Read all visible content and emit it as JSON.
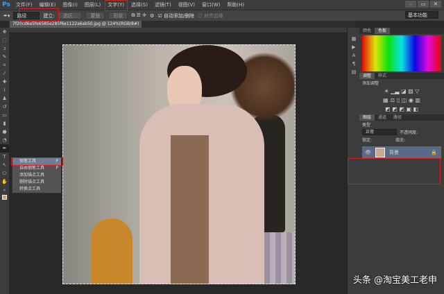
{
  "app": {
    "logo": "Ps"
  },
  "menu": [
    "文件(F)",
    "编辑(E)",
    "图像(I)",
    "图层(L)",
    "文字(Y)",
    "选择(S)",
    "滤镜(T)",
    "视图(V)",
    "窗口(W)",
    "帮助(H)"
  ],
  "window_buttons": [
    "–",
    "▭",
    "✕"
  ],
  "options": {
    "mode": "路径",
    "make_label": "建立:",
    "selection": "选区...",
    "mask": "蒙版",
    "shape": "形状",
    "auto_add": "自动添加/删除",
    "align_edges": "对齐边缘",
    "workspace": "基本功能"
  },
  "document": {
    "tab": "7f20cd6e5fe6585e285f6e1122a6ab50.jpg @ 124%(RGB/8#)",
    "zoom": "124%"
  },
  "flyout": [
    {
      "label": "钢笔工具",
      "key": "P",
      "active": true
    },
    {
      "label": "自由钢笔工具",
      "key": "P"
    },
    {
      "label": "添加锚点工具",
      "key": ""
    },
    {
      "label": "删除锚点工具",
      "key": ""
    },
    {
      "label": "转换点工具",
      "key": ""
    }
  ],
  "panels": {
    "color_tabs": [
      "颜色",
      "色板"
    ],
    "adjust_tabs": [
      "调整",
      "样式"
    ],
    "add_adjustment": "添加调整",
    "layer_tabs": [
      "图层",
      "通道",
      "路径"
    ],
    "kind": "类型",
    "blend": "正常",
    "opacity": "不透明度:",
    "lock": "锁定:",
    "fill": "填充:",
    "layer_name": "背景"
  },
  "watermark": "头条 @淘宝美工老申"
}
